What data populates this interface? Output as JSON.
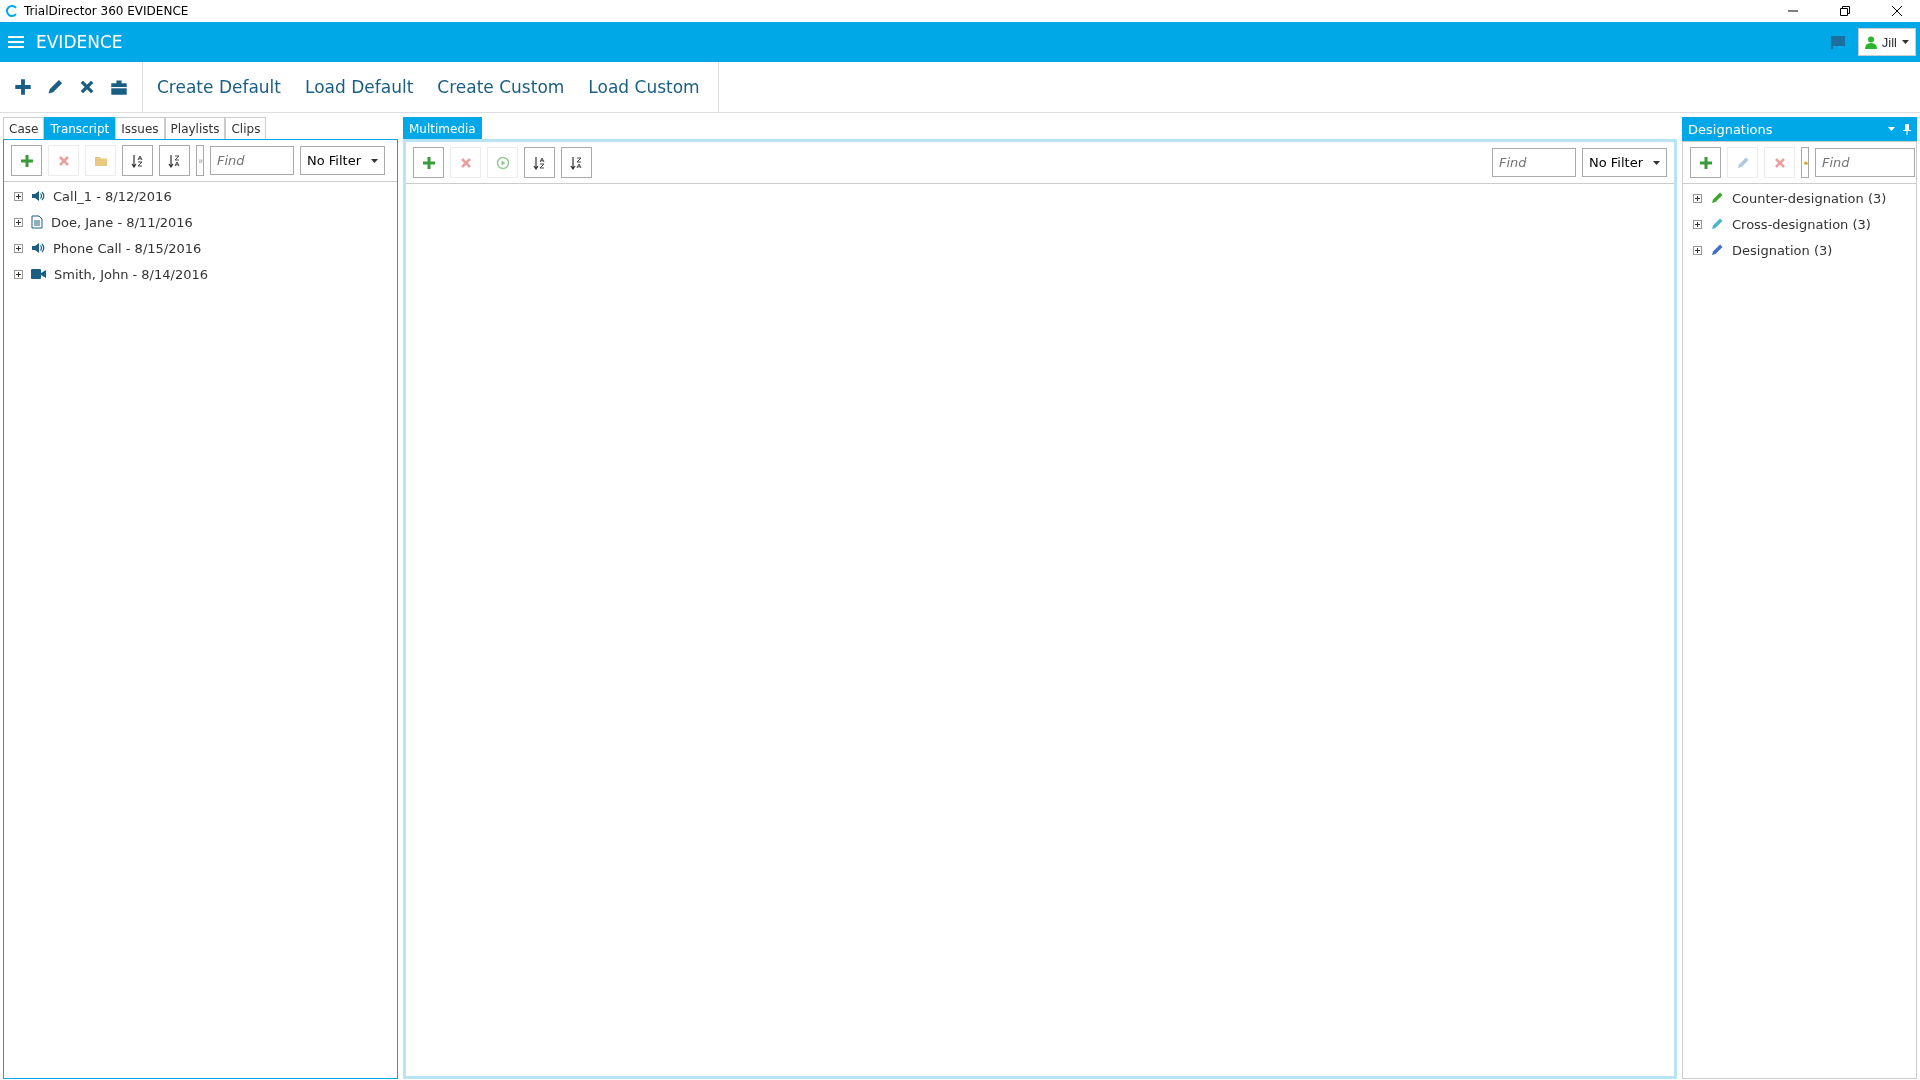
{
  "window": {
    "title": "TrialDirector 360 EVIDENCE"
  },
  "header": {
    "title": "EVIDENCE",
    "user": "Jill"
  },
  "toolbar": {
    "icons": [
      {
        "kind": "add"
      },
      {
        "kind": "edit"
      },
      {
        "kind": "delete"
      },
      {
        "kind": "briefcase"
      }
    ],
    "links": [
      "Create Default",
      "Load Default",
      "Create Custom",
      "Load Custom"
    ]
  },
  "left_panel": {
    "tabs": [
      {
        "label": "Case",
        "selected": false
      },
      {
        "label": "Transcript",
        "selected": true
      },
      {
        "label": "Issues",
        "selected": false
      },
      {
        "label": "Playlists",
        "selected": false
      },
      {
        "label": "Clips",
        "selected": false
      }
    ],
    "buttons": [
      {
        "kind": "add",
        "disabled": false
      },
      {
        "kind": "delete",
        "disabled": true
      },
      {
        "kind": "folder",
        "disabled": true
      },
      {
        "kind": "sort-asc",
        "disabled": false
      },
      {
        "kind": "sort-desc",
        "disabled": false
      },
      {
        "kind": "sort-cut",
        "disabled": false
      }
    ],
    "search": {
      "placeholder": "Find"
    },
    "filter": "No Filter",
    "items": [
      {
        "kind": "audio",
        "label": "Call_1 - 8/12/2016",
        "expanded": false
      },
      {
        "kind": "document",
        "label": "Doe, Jane - 8/11/2016",
        "expanded": false
      },
      {
        "kind": "audio",
        "label": "Phone Call - 8/15/2016",
        "expanded": false
      },
      {
        "kind": "video",
        "label": "Smith, John - 8/14/2016",
        "expanded": false
      }
    ]
  },
  "center_panel": {
    "tab": "Multimedia",
    "buttons": [
      {
        "kind": "add",
        "disabled": false
      },
      {
        "kind": "delete",
        "disabled": true
      },
      {
        "kind": "play",
        "disabled": true
      },
      {
        "kind": "sort-asc",
        "disabled": false
      },
      {
        "kind": "sort-desc",
        "disabled": false
      }
    ],
    "search": {
      "placeholder": "Find"
    },
    "filter": "No Filter"
  },
  "right_panel": {
    "title": "Designations",
    "buttons": [
      {
        "kind": "add",
        "disabled": false
      },
      {
        "kind": "edit",
        "disabled": true
      },
      {
        "kind": "delete",
        "disabled": true
      },
      {
        "kind": "folder-cut",
        "disabled": false
      }
    ],
    "search": {
      "placeholder": "Find"
    },
    "items": [
      {
        "label": "Counter-designation (3)",
        "color": "#3aa829",
        "expanded": false
      },
      {
        "label": "Cross-designation (3)",
        "color": "#4fb3c9",
        "expanded": false
      },
      {
        "label": "Designation (3)",
        "color": "#3f6fc4",
        "expanded": false
      }
    ]
  }
}
